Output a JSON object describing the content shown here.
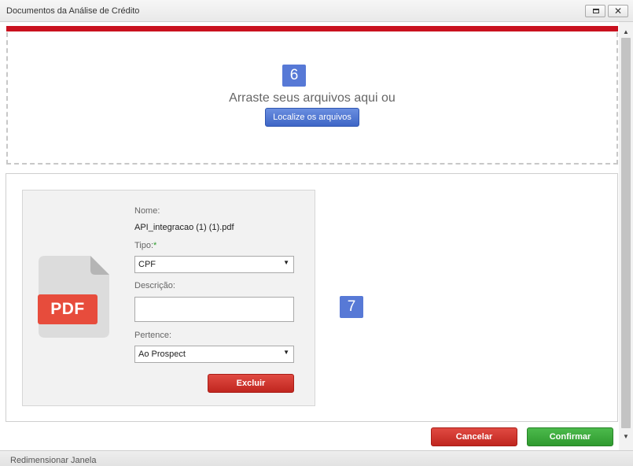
{
  "window": {
    "title": "Documentos da Análise de Crédito",
    "close_glyph": "✕"
  },
  "upload": {
    "step_badge": "6",
    "drop_text": "Arraste seus arquivos aqui ou",
    "locate_button": "Localize os arquivos"
  },
  "file_panel": {
    "step_badge": "7",
    "file": {
      "icon_label": "PDF",
      "name_label": "Nome:",
      "name_value": "API_integracao (1) (1).pdf",
      "type_label": "Tipo:",
      "type_required": "*",
      "type_value": "CPF",
      "description_label": "Descrição:",
      "description_value": "",
      "belongs_label": "Pertence:",
      "belongs_value": "Ao Prospect",
      "delete_button": "Excluir"
    }
  },
  "footer": {
    "cancel_button": "Cancelar",
    "confirm_button": "Confirmar"
  },
  "statusbar": {
    "resize_label": "Redimensionar Janela"
  },
  "icons": {
    "restore": "restore-icon",
    "close": "close-icon",
    "caret": "chevron-down-icon",
    "scroll_up": "scroll-up-icon",
    "scroll_down": "scroll-down-icon",
    "file": "pdf-file-icon"
  },
  "colors": {
    "brand_red": "#c9111f",
    "step_badge": "#5779d6",
    "primary_blue": "#3e66c6",
    "danger_red": "#c0261f",
    "success_green": "#2f9a2f",
    "pdf_red": "#e74c3c"
  }
}
